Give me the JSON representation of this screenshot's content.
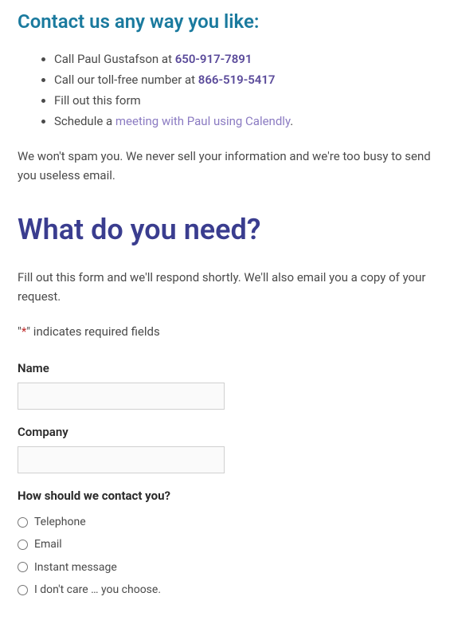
{
  "contact": {
    "heading": "Contact us any way you like:",
    "items": {
      "call_paul_prefix": "Call Paul Gustafson at ",
      "call_paul_phone": "650-917-7891",
      "toll_free_prefix": "Call our toll-free number at ",
      "toll_free_phone": "866-519-5417",
      "fill_form": "Fill out this form",
      "schedule_prefix": "Schedule a ",
      "schedule_link": "meeting with Paul using Calendly",
      "schedule_suffix": "."
    },
    "no_spam": "We won't spam you. We never sell your information and we're too busy to send you useless email."
  },
  "form": {
    "heading": "What do you need?",
    "intro": "Fill out this form and we'll respond shortly. We'll also email you a copy of your request.",
    "required_prefix": "\"",
    "required_asterisk": "*",
    "required_suffix": "\" indicates required fields",
    "fields": {
      "name_label": "Name",
      "company_label": "Company",
      "contact_method_label": "How should we contact you?",
      "options": {
        "telephone": "Telephone",
        "email": "Email",
        "instant_message": "Instant message",
        "dont_care": "I don't care … you choose."
      }
    }
  }
}
